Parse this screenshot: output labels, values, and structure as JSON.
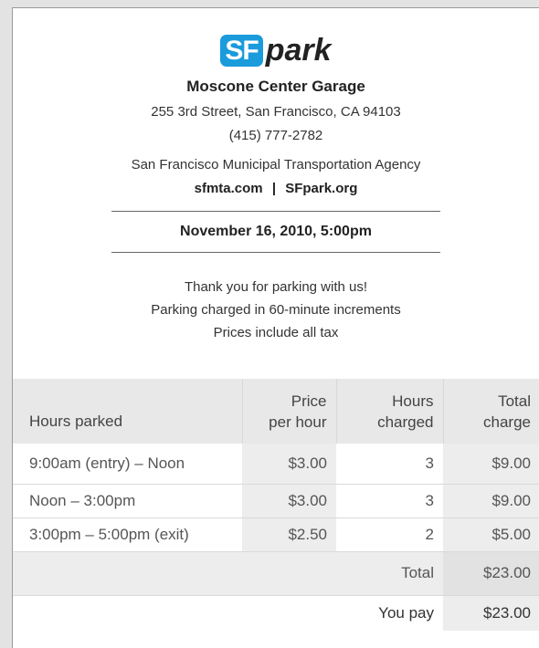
{
  "brand": {
    "logo_sf": "SF",
    "logo_park": "park",
    "logo_color": "#1a9bdb"
  },
  "garage": {
    "name": "Moscone Center Garage",
    "address": "255 3rd Street, San Francisco, CA 94103",
    "phone": "(415) 777-2782"
  },
  "agency": {
    "name": "San Francisco Municipal Transportation Agency",
    "link1": "sfmta.com",
    "separator": "|",
    "link2": "SFpark.org"
  },
  "datetime": "November 16, 2010, 5:00pm",
  "notes": [
    "Thank you for parking with us!",
    "Parking charged in 60-minute increments",
    "Prices include all tax"
  ],
  "table": {
    "headers": {
      "hours_parked": "Hours parked",
      "price_line1": "Price",
      "price_line2": "per hour",
      "hours_line1": "Hours",
      "hours_line2": "charged",
      "total_line1": "Total",
      "total_line2": "charge"
    },
    "rows": [
      {
        "period": "9:00am (entry) – Noon",
        "price": "$3.00",
        "hours": "3",
        "charge": "$9.00"
      },
      {
        "period": "Noon – 3:00pm",
        "price": "$3.00",
        "hours": "3",
        "charge": "$9.00"
      },
      {
        "period": "3:00pm – 5:00pm (exit)",
        "price": "$2.50",
        "hours": "2",
        "charge": "$5.00"
      }
    ],
    "total_label": "Total",
    "total_value": "$23.00",
    "pay_label": "You pay",
    "pay_value": "$23.00"
  }
}
